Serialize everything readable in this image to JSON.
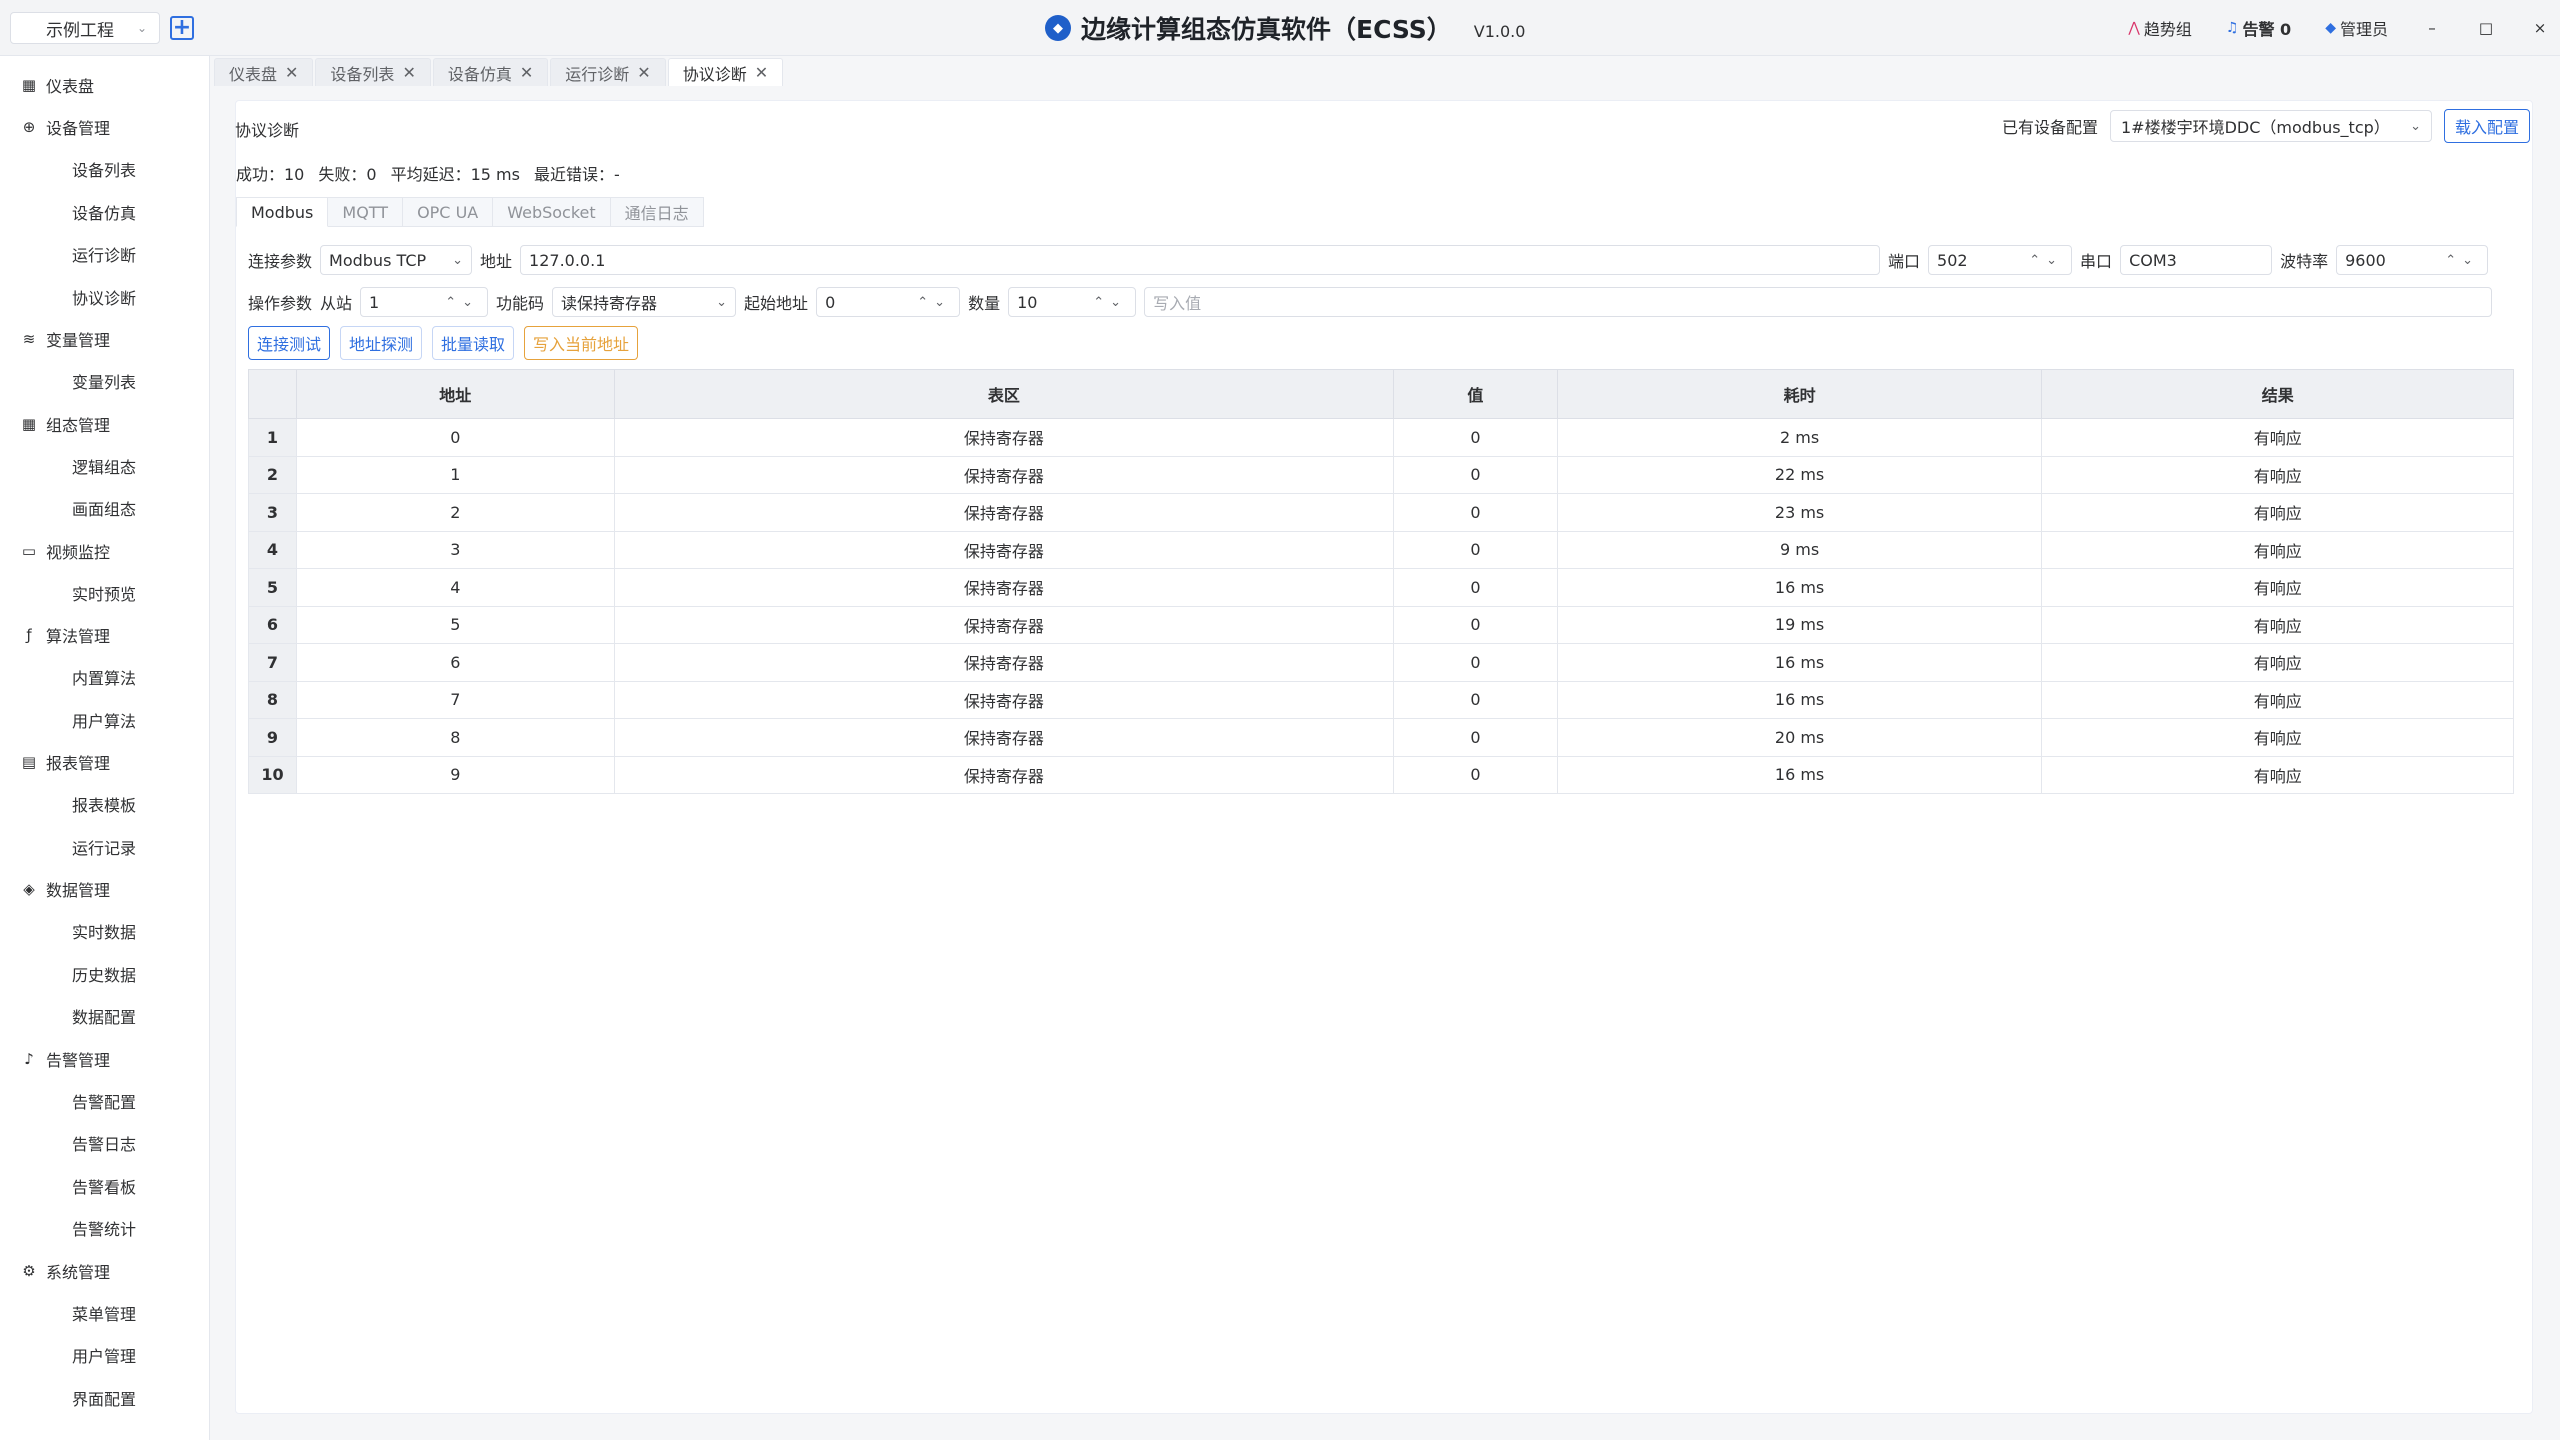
{
  "titlebar": {
    "project": "示例工程",
    "app_title": "边缘计算组态仿真软件（ECSS）",
    "version": "V1.0.0",
    "trend": "趋势组",
    "alarm": "告警 0",
    "admin": "管理员",
    "minimize": "–",
    "maximize": "□",
    "close": "×"
  },
  "sidebar": {
    "groups": [
      {
        "label": "仪表盘",
        "icon": "dashboard-icon",
        "items": []
      },
      {
        "label": "设备管理",
        "icon": "device-icon",
        "items": [
          "设备列表",
          "设备仿真",
          "运行诊断",
          "协议诊断"
        ]
      },
      {
        "label": "变量管理",
        "icon": "database-icon",
        "items": [
          "变量列表"
        ]
      },
      {
        "label": "组态管理",
        "icon": "grid-icon",
        "items": [
          "逻辑组态",
          "画面组态"
        ]
      },
      {
        "label": "视频监控",
        "icon": "folder-icon",
        "items": [
          "实时预览"
        ]
      },
      {
        "label": "算法管理",
        "icon": "function-icon",
        "items": [
          "内置算法",
          "用户算法"
        ]
      },
      {
        "label": "报表管理",
        "icon": "report-icon",
        "items": [
          "报表模板",
          "运行记录"
        ]
      },
      {
        "label": "数据管理",
        "icon": "layers-icon",
        "items": [
          "实时数据",
          "历史数据",
          "数据配置"
        ]
      },
      {
        "label": "告警管理",
        "icon": "bell-icon",
        "items": [
          "告警配置",
          "告警日志",
          "告警看板",
          "告警统计"
        ]
      },
      {
        "label": "系统管理",
        "icon": "settings-icon",
        "items": [
          "菜单管理",
          "用户管理",
          "界面配置"
        ]
      }
    ]
  },
  "tabs": [
    {
      "label": "仪表盘",
      "active": false
    },
    {
      "label": "设备列表",
      "active": false
    },
    {
      "label": "设备仿真",
      "active": false
    },
    {
      "label": "运行诊断",
      "active": false
    },
    {
      "label": "协议诊断",
      "active": true
    }
  ],
  "main": {
    "title": "协议诊断",
    "config_label": "已有设备配置",
    "config_value": "1#楼楼宇环境DDC（modbus_tcp）",
    "load_button": "载入配置",
    "stats": {
      "success": "成功：10",
      "fail": "失败：0",
      "latency": "平均延迟：15 ms",
      "last_error": "最近错误：-"
    },
    "subtabs": [
      "Modbus",
      "MQTT",
      "OPC UA",
      "WebSocket",
      "通信日志"
    ],
    "conn": {
      "label": "连接参数",
      "protocol": "Modbus TCP",
      "addr_label": "地址",
      "addr": "127.0.0.1",
      "port_label": "端口",
      "port": "502",
      "serial_label": "串口",
      "serial": "COM3",
      "baud_label": "波特率",
      "baud": "9600"
    },
    "op": {
      "label": "操作参数",
      "slave_label": "从站",
      "slave": "1",
      "func_label": "功能码",
      "func": "读保持寄存器",
      "start_label": "起始地址",
      "start": "0",
      "count_label": "数量",
      "count": "10",
      "write_placeholder": "写入值"
    },
    "buttons": {
      "test": "连接测试",
      "probe": "地址探测",
      "batch": "批量读取",
      "write": "写入当前地址"
    },
    "table": {
      "headers": [
        "地址",
        "表区",
        "值",
        "耗时",
        "结果"
      ],
      "rows": [
        [
          "1",
          "0",
          "保持寄存器",
          "0",
          "2 ms",
          "有响应"
        ],
        [
          "2",
          "1",
          "保持寄存器",
          "0",
          "22 ms",
          "有响应"
        ],
        [
          "3",
          "2",
          "保持寄存器",
          "0",
          "23 ms",
          "有响应"
        ],
        [
          "4",
          "3",
          "保持寄存器",
          "0",
          "9 ms",
          "有响应"
        ],
        [
          "5",
          "4",
          "保持寄存器",
          "0",
          "16 ms",
          "有响应"
        ],
        [
          "6",
          "5",
          "保持寄存器",
          "0",
          "19 ms",
          "有响应"
        ],
        [
          "7",
          "6",
          "保持寄存器",
          "0",
          "16 ms",
          "有响应"
        ],
        [
          "8",
          "7",
          "保持寄存器",
          "0",
          "16 ms",
          "有响应"
        ],
        [
          "9",
          "8",
          "保持寄存器",
          "0",
          "20 ms",
          "有响应"
        ],
        [
          "10",
          "9",
          "保持寄存器",
          "0",
          "16 ms",
          "有响应"
        ]
      ]
    }
  }
}
